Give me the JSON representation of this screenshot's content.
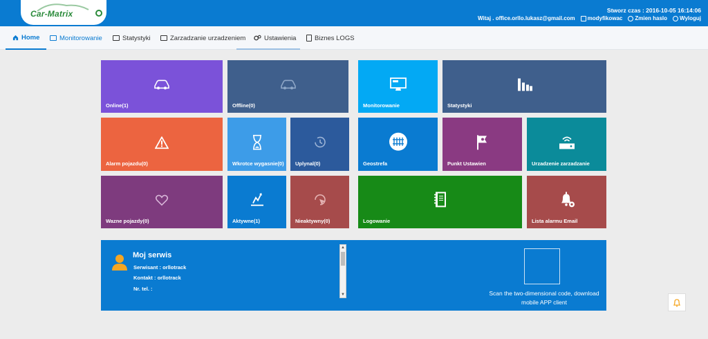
{
  "header": {
    "logo_text": "Car-Matrix",
    "create_time": "Stworz czas : 2016-10-05 16:14:06",
    "welcome": "Witaj . office.orllo.lukasz@gmail.com",
    "modify_label": "modyfikowac",
    "change_password_label": "Zmien haslo",
    "logout_label": "Wyloguj"
  },
  "nav": {
    "tabs": [
      {
        "label": "Home",
        "icon": "home-icon"
      },
      {
        "label": "Monitorowanie",
        "icon": "map-icon"
      },
      {
        "label": "Statystyki",
        "icon": "table-icon"
      },
      {
        "label": "Zarzadzanie urzadzeniem",
        "icon": "device-icon"
      },
      {
        "label": "Ustawienia",
        "icon": "gears-icon"
      },
      {
        "label": "Biznes LOGS",
        "icon": "file-icon"
      }
    ]
  },
  "tiles": {
    "online": {
      "label": "Online(1)",
      "color": "#7b52d9"
    },
    "offline": {
      "label": "Offline(0)",
      "color": "#3f5f8c"
    },
    "monitor": {
      "label": "Monitorowanie",
      "color": "#03a9f4"
    },
    "stats": {
      "label": "Statystyki",
      "color": "#3f5f8c"
    },
    "alarm": {
      "label": "Alarm pojazdu(0)",
      "color": "#ec6440"
    },
    "expiring": {
      "label": "Wkrotce wygasnie(0)",
      "color": "#3d9ce8"
    },
    "expired": {
      "label": "Uplynal(0)",
      "color": "#2c5a9c"
    },
    "geofence": {
      "label": "Geostrefa",
      "color": "#0a7bd1"
    },
    "poi": {
      "label": "Punkt Ustawien",
      "color": "#8a3a82"
    },
    "device_mgmt": {
      "label": "Urzadzenie zarzadzanie",
      "color": "#0b8b9a"
    },
    "important": {
      "label": "Wazne pojazdy(0)",
      "color": "#7e3b7e"
    },
    "active": {
      "label": "Aktywne(1)",
      "color": "#0a7bd1"
    },
    "inactive": {
      "label": "Nieaktywny(0)",
      "color": "#a64b4b"
    },
    "logs": {
      "label": "Logowanie",
      "color": "#178a17"
    },
    "email_alarm": {
      "label": "Lista alarmu Email",
      "color": "#a64b4b"
    }
  },
  "service": {
    "title": "Moj serwis",
    "servicer": "Serwisant : orllotrack",
    "contact": "Kontakt : orllotrack",
    "phone": "Nr. tel. :",
    "scan_text": "Scan the two-dimensional code, download mobile APP client"
  }
}
